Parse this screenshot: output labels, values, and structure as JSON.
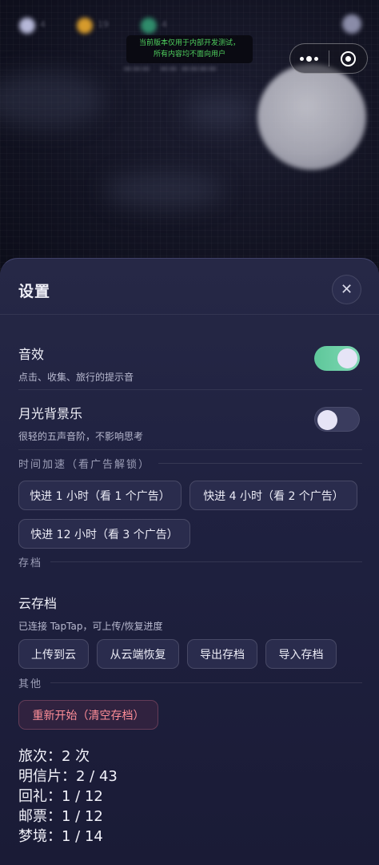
{
  "notice": {
    "line1": "当前版本仅用于内部开发测试，",
    "line2": "所有内容均不面向用户"
  },
  "background": {
    "hud_values": [
      "4",
      "19",
      "4"
    ]
  },
  "settings": {
    "title": "设置",
    "close_glyph": "✕",
    "sound": {
      "title": "音效",
      "desc": "点击、收集、旅行的提示音",
      "enabled": true
    },
    "music": {
      "title": "月光背景乐",
      "desc": "很轻的五声音阶，不影响思考",
      "enabled": false
    },
    "speedup": {
      "section": "时间加速（看广告解锁）",
      "buttons": [
        "快进 1 小时（看 1 个广告）",
        "快进 4 小时（看 2 个广告）",
        "快进 12 小时（看 3 个广告）"
      ]
    },
    "save": {
      "section": "存档",
      "title": "云存档",
      "desc": "已连接 TapTap，可上传/恢复进度",
      "buttons": [
        "上传到云",
        "从云端恢复",
        "导出存档",
        "导入存档"
      ]
    },
    "other": {
      "section": "其他",
      "reset": "重新开始（清空存档）"
    },
    "stats": [
      "旅次：2 次",
      "明信片：2 / 43",
      "回礼：1 / 12",
      "邮票：1 / 12",
      "梦境：1 / 14"
    ]
  },
  "colors": {
    "toggle_on": "#6fd2a8",
    "danger": "#ff8e98",
    "notice_text": "#4fd05e"
  }
}
